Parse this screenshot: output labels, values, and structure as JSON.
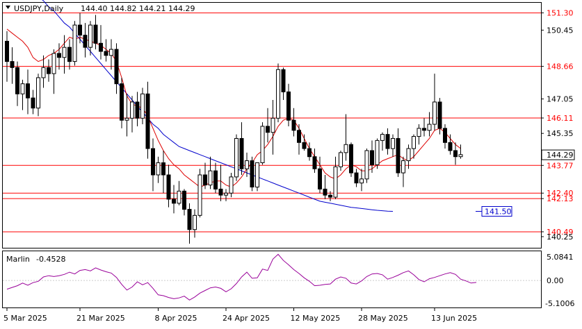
{
  "header": {
    "symbol": "USDJPY,Daily",
    "ohlc": "144.40 144.82 144.21 144.29"
  },
  "indicator": {
    "name": "Marlin",
    "value": "-0.4528",
    "ticks": [
      "5.0841",
      "0.00",
      "-5.1006"
    ]
  },
  "colors": {
    "background": "#ffffff",
    "candle": "#000000",
    "level_line": "#ff0000",
    "level_text": "#ff0000",
    "ma_red": "#dd0000",
    "ma_blue": "#0000cc",
    "oscillator": "#990099",
    "axis": "#000000"
  },
  "chart_data": [
    {
      "type": "candlestick",
      "symbol": "USDJPY",
      "timeframe": "Daily",
      "y_range": [
        139.7,
        151.8
      ],
      "y_ticks": [
        {
          "label": "151.30",
          "value": 151.3,
          "highlight": true
        },
        {
          "label": "150.45",
          "value": 150.45
        },
        {
          "label": "148.66",
          "value": 148.66,
          "highlight": true
        },
        {
          "label": "147.05",
          "value": 147.05
        },
        {
          "label": "146.11",
          "value": 146.11,
          "highlight": true
        },
        {
          "label": "145.35",
          "value": 145.35
        },
        {
          "label": "143.77",
          "value": 143.77,
          "highlight": true
        },
        {
          "label": "142.40",
          "value": 142.4,
          "highlight": true
        },
        {
          "label": "142.13",
          "value": 142.13,
          "highlight": true
        },
        {
          "label": "140.49",
          "value": 140.49,
          "highlight": true
        },
        {
          "label": "140.25",
          "value": 140.25
        }
      ],
      "current_price": {
        "label": "144.29",
        "value": 144.29
      },
      "levels": [
        151.3,
        148.66,
        146.11,
        143.77,
        142.4,
        142.13,
        140.49
      ],
      "ma_label": {
        "text": "141.50",
        "value": 141.5
      },
      "x_labels": [
        "5 Mar 2025",
        "21 Mar 2025",
        "8 Apr 2025",
        "24 Apr 2025",
        "12 May 2025",
        "28 May 2025",
        "13 Jun 2025"
      ],
      "x_label_index": [
        0,
        14,
        29,
        42,
        55,
        68,
        82
      ],
      "candles": [
        [
          149.9,
          150.4,
          147.9,
          148.9
        ],
        [
          148.9,
          149.6,
          147.8,
          148.6
        ],
        [
          148.6,
          148.9,
          146.7,
          147.3
        ],
        [
          147.3,
          148.0,
          146.5,
          147.8
        ],
        [
          147.8,
          148.5,
          146.3,
          147.1
        ],
        [
          147.1,
          147.5,
          146.3,
          146.6
        ],
        [
          146.6,
          148.3,
          146.2,
          148.1
        ],
        [
          148.1,
          149.2,
          147.6,
          148.6
        ],
        [
          148.6,
          149.0,
          147.9,
          148.3
        ],
        [
          148.3,
          149.5,
          147.3,
          149.3
        ],
        [
          149.3,
          149.8,
          148.5,
          149.1
        ],
        [
          149.1,
          150.2,
          148.3,
          149.6
        ],
        [
          149.6,
          150.0,
          148.5,
          148.9
        ],
        [
          148.9,
          150.9,
          148.7,
          150.7
        ],
        [
          150.7,
          151.3,
          149.8,
          150.2
        ],
        [
          150.2,
          150.8,
          149.1,
          149.6
        ],
        [
          149.6,
          150.9,
          149.2,
          150.7
        ],
        [
          150.7,
          151.2,
          149.5,
          149.8
        ],
        [
          149.8,
          150.7,
          149.0,
          149.4
        ],
        [
          149.4,
          150.0,
          148.9,
          149.2
        ],
        [
          149.2,
          150.0,
          148.5,
          149.5
        ],
        [
          149.5,
          149.8,
          147.3,
          147.8
        ],
        [
          147.8,
          148.1,
          145.6,
          146.0
        ],
        [
          146.0,
          147.3,
          145.2,
          146.1
        ],
        [
          146.1,
          147.2,
          145.4,
          146.9
        ],
        [
          146.9,
          147.4,
          145.7,
          146.1
        ],
        [
          146.1,
          147.6,
          145.8,
          147.3
        ],
        [
          147.3,
          147.9,
          144.1,
          144.6
        ],
        [
          144.6,
          145.1,
          142.5,
          143.3
        ],
        [
          143.3,
          144.2,
          142.9,
          143.9
        ],
        [
          143.9,
          144.5,
          142.4,
          143.3
        ],
        [
          143.3,
          143.8,
          141.7,
          142.1
        ],
        [
          142.1,
          142.8,
          141.4,
          141.9
        ],
        [
          141.9,
          143.0,
          141.8,
          142.5
        ],
        [
          142.5,
          142.6,
          141.3,
          141.6
        ],
        [
          141.6,
          141.9,
          139.9,
          140.6
        ],
        [
          140.6,
          141.6,
          140.2,
          141.3
        ],
        [
          141.3,
          143.6,
          141.2,
          143.3
        ],
        [
          143.3,
          143.9,
          142.6,
          142.8
        ],
        [
          142.8,
          144.2,
          142.6,
          143.5
        ],
        [
          143.5,
          143.9,
          142.4,
          142.6
        ],
        [
          142.6,
          143.8,
          142.0,
          142.3
        ],
        [
          142.3,
          142.6,
          142.0,
          142.4
        ],
        [
          142.4,
          143.4,
          142.2,
          143.2
        ],
        [
          143.2,
          145.3,
          143.0,
          145.1
        ],
        [
          145.1,
          145.9,
          143.3,
          143.6
        ],
        [
          143.6,
          144.4,
          143.2,
          144.0
        ],
        [
          144.0,
          144.2,
          142.5,
          142.7
        ],
        [
          142.7,
          143.9,
          142.5,
          143.9
        ],
        [
          143.9,
          145.9,
          143.8,
          145.7
        ],
        [
          145.7,
          146.6,
          144.9,
          145.4
        ],
        [
          145.4,
          147.0,
          144.3,
          146.1
        ],
        [
          146.1,
          148.8,
          145.9,
          148.5
        ],
        [
          148.5,
          148.6,
          147.0,
          147.4
        ],
        [
          147.4,
          147.8,
          145.7,
          146.0
        ],
        [
          146.0,
          146.6,
          145.2,
          145.5
        ],
        [
          145.5,
          145.8,
          144.3,
          144.9
        ],
        [
          144.9,
          145.3,
          144.5,
          144.6
        ],
        [
          144.6,
          144.9,
          144.0,
          144.2
        ],
        [
          144.2,
          144.6,
          143.4,
          143.6
        ],
        [
          143.6,
          144.2,
          142.4,
          142.6
        ],
        [
          142.6,
          143.3,
          142.1,
          142.3
        ],
        [
          142.3,
          142.5,
          142.0,
          142.2
        ],
        [
          142.2,
          144.2,
          142.1,
          143.7
        ],
        [
          143.7,
          144.5,
          143.5,
          144.4
        ],
        [
          144.4,
          146.3,
          144.0,
          144.8
        ],
        [
          144.8,
          144.9,
          143.2,
          143.4
        ],
        [
          143.4,
          143.6,
          142.7,
          142.9
        ],
        [
          142.9,
          143.6,
          142.5,
          143.1
        ],
        [
          143.1,
          144.6,
          142.9,
          144.5
        ],
        [
          144.5,
          145.0,
          143.4,
          143.8
        ],
        [
          143.8,
          145.1,
          143.6,
          145.0
        ],
        [
          145.0,
          145.4,
          144.5,
          145.3
        ],
        [
          145.3,
          145.6,
          144.3,
          144.6
        ],
        [
          144.6,
          145.3,
          144.2,
          145.1
        ],
        [
          145.1,
          145.6,
          143.2,
          143.4
        ],
        [
          143.4,
          144.2,
          142.7,
          144.0
        ],
        [
          144.0,
          144.8,
          143.6,
          144.6
        ],
        [
          144.6,
          145.3,
          144.1,
          145.2
        ],
        [
          145.2,
          145.8,
          144.8,
          145.6
        ],
        [
          145.6,
          146.1,
          145.2,
          145.5
        ],
        [
          145.5,
          146.4,
          145.2,
          145.8
        ],
        [
          145.8,
          148.3,
          145.5,
          146.9
        ],
        [
          146.9,
          147.1,
          145.3,
          145.6
        ],
        [
          145.6,
          145.8,
          144.6,
          144.9
        ],
        [
          144.9,
          145.3,
          144.3,
          144.5
        ],
        [
          144.5,
          144.9,
          143.8,
          144.2
        ],
        [
          144.2,
          144.8,
          144.1,
          144.3
        ]
      ],
      "ma_red": [
        150.5,
        150.3,
        150.1,
        149.9,
        149.6,
        149.1,
        148.9,
        149.0,
        149.2,
        149.3,
        149.5,
        149.8,
        150.1,
        150.0,
        150.1,
        150.0,
        149.9,
        149.8,
        149.7,
        149.5,
        149.3,
        148.9,
        148.1,
        147.2,
        146.8,
        146.7,
        146.6,
        146.2,
        145.6,
        145.0,
        144.5,
        144.1,
        143.8,
        143.6,
        143.3,
        143.1,
        142.9,
        142.7,
        142.8,
        142.9,
        143.0,
        143.0,
        142.8,
        142.7,
        142.9,
        143.2,
        143.6,
        143.9,
        144.3,
        144.5,
        144.8,
        145.2,
        145.7,
        146.0,
        146.1,
        146.0,
        145.6,
        145.1,
        144.6,
        144.2,
        143.8,
        143.4,
        143.2,
        143.1,
        143.3,
        143.6,
        143.8,
        143.7,
        143.5,
        143.5,
        143.6,
        143.8,
        144.0,
        144.1,
        144.2,
        144.3,
        144.1,
        144.0,
        144.2,
        144.5,
        144.8,
        145.1,
        145.5,
        145.6,
        145.4,
        145.1,
        144.8,
        144.6
      ],
      "ma_blue": [
        153.5,
        153.3,
        153.1,
        152.8,
        152.6,
        152.4,
        152.1,
        151.9,
        151.6,
        151.4,
        151.1,
        150.8,
        150.6,
        150.3,
        150.0,
        149.7,
        149.4,
        149.1,
        148.8,
        148.5,
        148.2,
        147.9,
        147.6,
        147.3,
        147.0,
        146.7,
        146.4,
        146.1,
        145.8,
        145.6,
        145.3,
        145.1,
        144.9,
        144.7,
        144.6,
        144.5,
        144.4,
        144.3,
        144.2,
        144.1,
        144.0,
        143.9,
        143.8,
        143.7,
        143.6,
        143.5,
        143.4,
        143.3,
        143.2,
        143.1,
        143.0,
        142.9,
        142.8,
        142.7,
        142.6,
        142.5,
        142.4,
        142.3,
        142.2,
        142.1,
        142.0,
        141.95,
        141.9,
        141.85,
        141.8,
        141.75,
        141.7,
        141.67,
        141.64,
        141.61,
        141.58,
        141.55,
        141.53,
        141.51,
        141.5
      ],
      "oscillator": {
        "name": "Marlin",
        "range": [
          -6.2,
          6.7
        ],
        "values": [
          -2.0,
          -1.6,
          -1.2,
          -0.6,
          -1.1,
          -0.5,
          -0.2,
          0.8,
          1.1,
          0.9,
          1.1,
          1.4,
          1.9,
          1.5,
          2.3,
          2.5,
          2.2,
          2.9,
          2.4,
          2.0,
          1.7,
          0.7,
          -0.9,
          -2.2,
          -1.5,
          -0.3,
          -1.0,
          -0.5,
          -1.8,
          -3.3,
          -3.5,
          -3.9,
          -4.2,
          -4.0,
          -3.6,
          -4.5,
          -3.8,
          -2.9,
          -2.3,
          -1.7,
          -1.5,
          -1.8,
          -2.6,
          -1.9,
          -0.7,
          0.8,
          1.9,
          0.5,
          0.6,
          2.6,
          2.3,
          4.9,
          6.0,
          4.6,
          3.6,
          2.5,
          1.6,
          0.6,
          -0.2,
          -1.2,
          -1.1,
          -0.9,
          -0.8,
          0.3,
          0.8,
          0.5,
          -0.6,
          -0.8,
          -0.1,
          0.9,
          1.5,
          1.6,
          1.3,
          0.3,
          0.7,
          1.2,
          1.8,
          2.2,
          1.3,
          0.2,
          -0.3,
          0.4,
          0.7,
          1.1,
          1.5,
          1.8,
          1.4,
          0.3,
          -0.1,
          -0.6,
          -0.45
        ]
      }
    }
  ]
}
